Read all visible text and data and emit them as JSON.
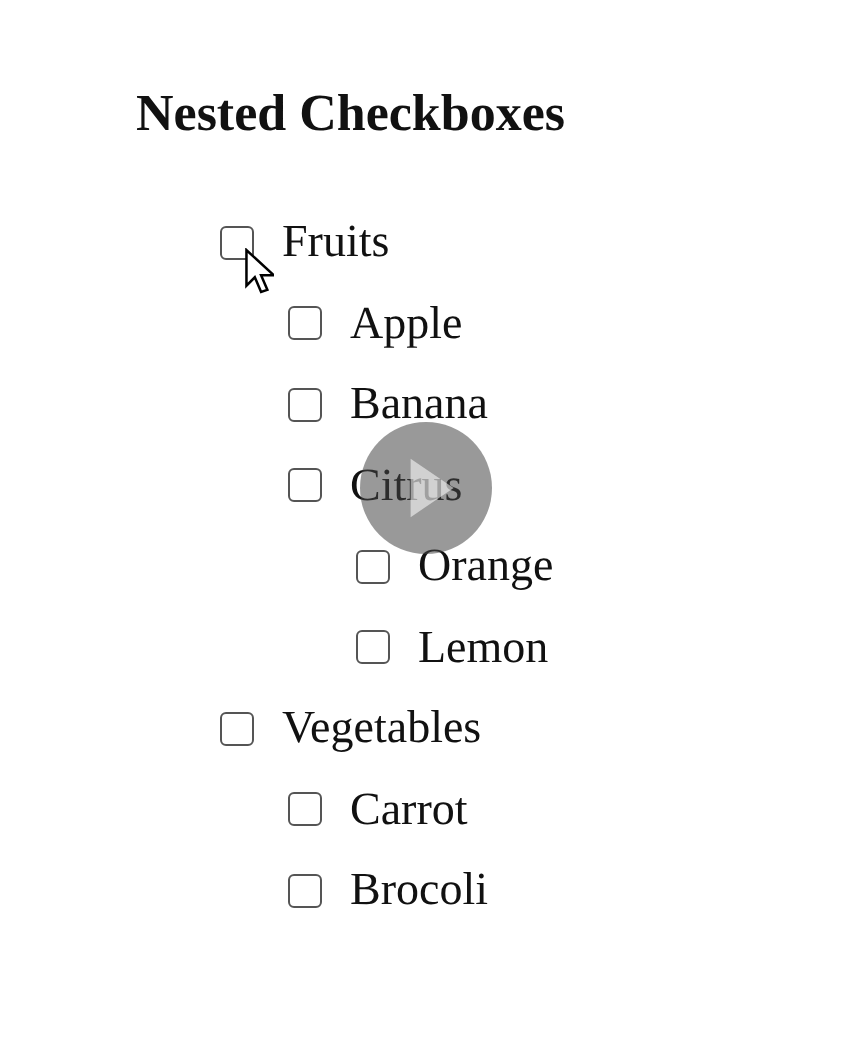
{
  "title": "Nested Checkboxes",
  "items": [
    {
      "label": "Fruits",
      "checked": false,
      "children": [
        {
          "label": "Apple",
          "checked": false
        },
        {
          "label": "Banana",
          "checked": false
        },
        {
          "label": "Citrus",
          "checked": false,
          "children": [
            {
              "label": "Orange",
              "checked": false
            },
            {
              "label": "Lemon",
              "checked": false
            }
          ]
        }
      ]
    },
    {
      "label": "Vegetables",
      "checked": false,
      "children": [
        {
          "label": "Carrot",
          "checked": false
        },
        {
          "label": "Brocoli",
          "checked": false
        }
      ]
    }
  ]
}
